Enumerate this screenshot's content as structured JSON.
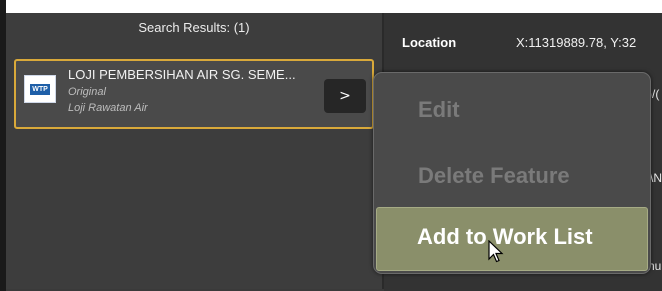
{
  "search_panel": {
    "header": "Search Results: (1)",
    "result": {
      "icon_text": "WTP",
      "title": "LOJI PEMBERSIHAN AIR SG. SEME...",
      "subtitle": "Original",
      "category": "Loji Rawatan Air",
      "go_label": ">"
    }
  },
  "details_panel": {
    "location_label": "Location",
    "location_value": "X:11319889.78, Y:32",
    "peek_row2": ")/(",
    "peek_row3": "\\N",
    "peek_row4": "nu"
  },
  "context_menu": {
    "items": [
      {
        "label": "Edit",
        "enabled": false
      },
      {
        "label": "Delete Feature",
        "enabled": false
      },
      {
        "label": "Add to Work List",
        "enabled": true,
        "highlighted": true
      }
    ]
  },
  "colors": {
    "selection_border": "#d9a93a",
    "highlight_item": "#8a8f6a",
    "wtp_badge": "#1e5fa8"
  },
  "icons": [
    "wtp-icon",
    "chevron-right-icon",
    "mouse-pointer-icon"
  ]
}
